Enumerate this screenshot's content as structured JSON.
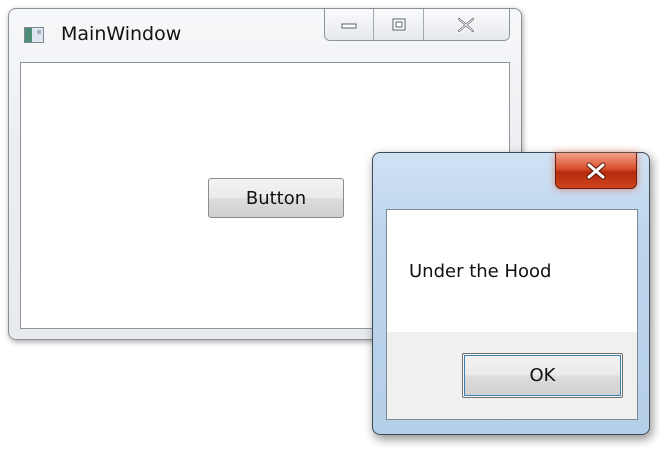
{
  "main_window": {
    "title": "MainWindow",
    "button_label": "Button",
    "icons": {
      "app": "app-window-icon",
      "minimize": "minimize-icon",
      "maximize": "maximize-icon",
      "close": "close-icon"
    }
  },
  "message_box": {
    "message": "Under the Hood",
    "ok_label": "OK",
    "icons": {
      "close": "close-icon"
    },
    "colors": {
      "close_button": "#d9502b"
    }
  }
}
